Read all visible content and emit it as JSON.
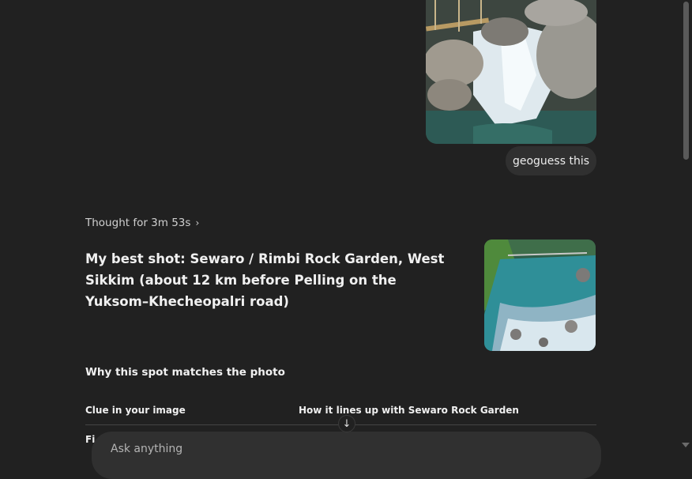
{
  "user_message": {
    "text": "geoguess this"
  },
  "thought": {
    "label": "Thought for 3m 53s",
    "chevron_icon": "chevron-right-icon"
  },
  "answer": {
    "heading": "My best shot: Sewaro / Rimbi Rock Garden, West Sikkim (about 12 km before Pelling on the Yuksom–Khecheopalri road)",
    "section_heading": "Why this spot matches the photo",
    "table": {
      "columns": [
        "Clue in your image",
        "How it lines up with Sewaro Rock Garden"
      ],
      "first_row_first_cell": "Fi"
    }
  },
  "scroll_down": {
    "icon": "arrow-down-icon",
    "glyph": "↓"
  },
  "composer": {
    "placeholder": "Ask anything"
  },
  "colors": {
    "background": "#212121",
    "bubble": "#303030",
    "text": "#ececec"
  }
}
